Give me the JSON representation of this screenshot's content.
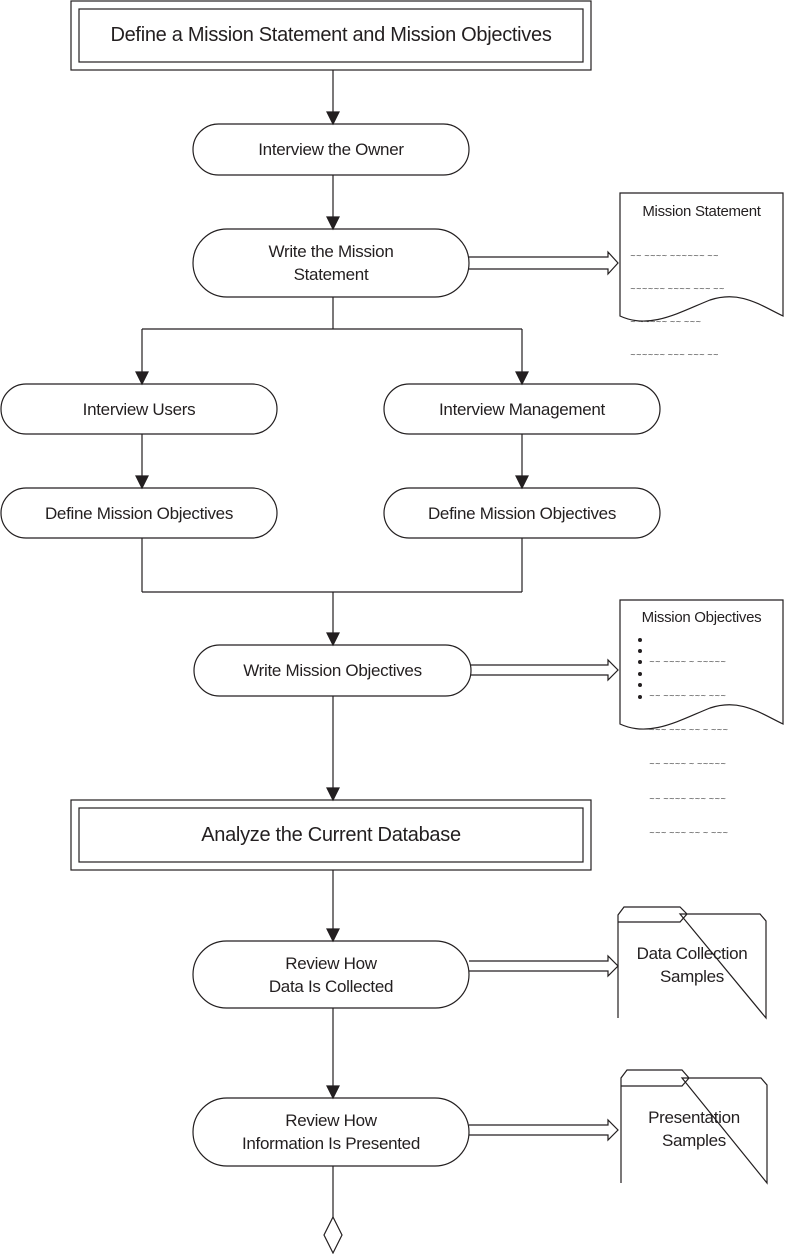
{
  "phases": [
    {
      "label": "Define a Mission Statement and Mission Objectives"
    },
    {
      "label": "Analyze the Current Database"
    }
  ],
  "steps": {
    "interview_owner": "Interview the Owner",
    "write_statement": [
      "Write the Mission",
      "Statement"
    ],
    "interview_users": "Interview Users",
    "interview_management": "Interview Management",
    "define_objectives_left": "Define Mission Objectives",
    "define_objectives_right": "Define Mission Objectives",
    "write_objectives": "Write Mission Objectives",
    "review_collected": [
      "Review How",
      "Data Is Collected"
    ],
    "review_presented": [
      "Review How",
      "Information Is Presented"
    ]
  },
  "documents": {
    "mission_statement": {
      "title": "Mission Statement",
      "lines": [
        "~~ ~~~~ ~~~~~~ ~~",
        "~~~~~~ ~~~~ ~~~ ~~",
        "~ ~~~~~ ~~ ~~~",
        "~~~~~~ ~~~ ~~~ ~~"
      ]
    },
    "mission_objectives": {
      "title": "Mission Objectives",
      "bullets": [
        "~~ ~~~~ ~ ~~~~~",
        "~~ ~~~~ ~~~ ~~~",
        "~~~ ~~~ ~~ ~ ~~~",
        "~~ ~~~~ ~ ~~~~~",
        "~~ ~~~~ ~~~ ~~~",
        "~~~ ~~~ ~~ ~ ~~~"
      ]
    }
  },
  "folders": {
    "data_collection": [
      "Data Collection",
      "Samples"
    ],
    "presentation": [
      "Presentation",
      "Samples"
    ]
  },
  "colors": {
    "stroke": "#231f20",
    "background": "#ffffff"
  }
}
